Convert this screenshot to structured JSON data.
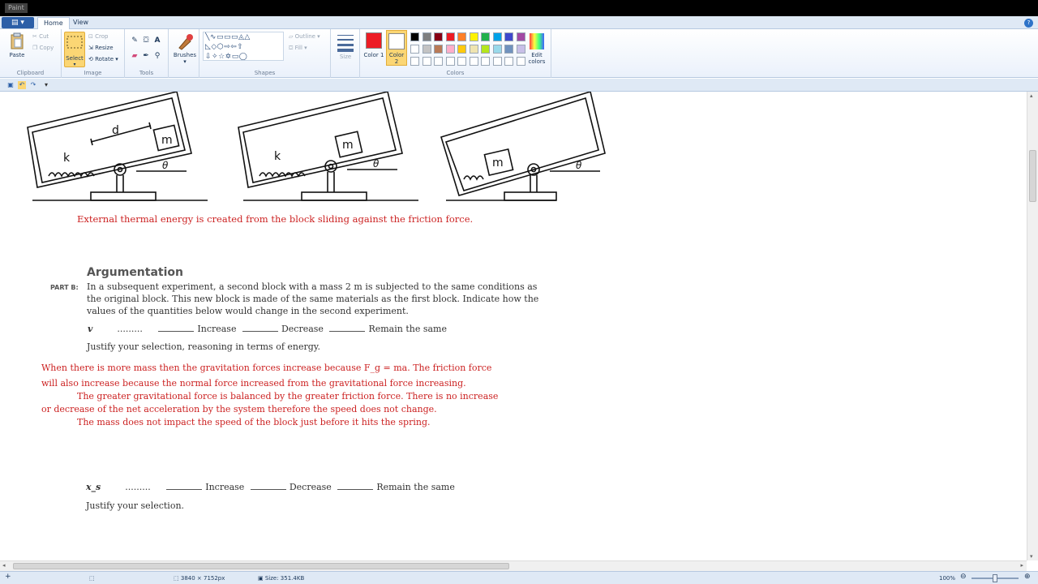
{
  "titlebar": {
    "title": "Paint"
  },
  "tabs": {
    "file_label": "▤ ▾",
    "home": "Home",
    "view": "View"
  },
  "ribbon": {
    "clipboard": {
      "paste": "Paste",
      "cut": "Cut",
      "copy": "Copy",
      "label": "Clipboard"
    },
    "image": {
      "select": "Select",
      "crop": "Crop",
      "resize": "Resize",
      "rotate": "Rotate",
      "label": "Image"
    },
    "tools": {
      "label": "Tools"
    },
    "brushes": {
      "label": "Brushes"
    },
    "shapes": {
      "outline": "Outline",
      "fill": "Fill",
      "label": "Shapes"
    },
    "size": {
      "label": "Size"
    },
    "colors": {
      "color1": "Color 1",
      "color2": "Color 2",
      "edit": "Edit colors",
      "label": "Colors",
      "color1_value": "#ed1c24",
      "color2_value": "#ffffff",
      "palette_row1": [
        "#000000",
        "#7f7f7f",
        "#880015",
        "#ed1c24",
        "#ff7f27",
        "#fff200",
        "#22b14c",
        "#00a2e8",
        "#3f48cc",
        "#a349a4"
      ],
      "palette_row2": [
        "#ffffff",
        "#c3c3c3",
        "#b97a57",
        "#ffaec9",
        "#ffc90e",
        "#efe4b0",
        "#b5e61d",
        "#99d9ea",
        "#7092be",
        "#c8bfe7"
      ]
    }
  },
  "document": {
    "diagram_labels": {
      "k": "k",
      "d": "d",
      "m": "m",
      "theta": "θ"
    },
    "answer1": "External thermal energy is created from the block sliding against the friction force.",
    "heading": "Argumentation",
    "part_label": "PART B:",
    "question": [
      "In a subsequent experiment, a second block with a mass 2 m is subjected to the same conditions as",
      "the original block. This new block is made of the same materials as the first block. Indicate how the",
      "values of the quantities below would change in the second experiment."
    ],
    "q1_var": "v",
    "dots": ".........",
    "increase": "Increase",
    "decrease": "Decrease",
    "remain": "Remain the same",
    "justify1": "Justify your selection, reasoning in terms of energy.",
    "answer2": [
      "When there is more mass then the gravitation forces increase because F_g = ma.  The friction force",
      "will also increase because the normal force increased from the gravitational force increasing.",
      "The greater gravitational force is balanced by the greater friction force. There is no increase",
      "or decrease of the net acceleration by the system therefore the speed does not change.",
      "The mass does not impact the speed of the block just before it hits the spring."
    ],
    "q2_var": "x_s",
    "justify2": "Justify your selection."
  },
  "status": {
    "dimensions": "3840 × 7152px",
    "size": "Size: 351.4KB",
    "zoom": "100%"
  }
}
